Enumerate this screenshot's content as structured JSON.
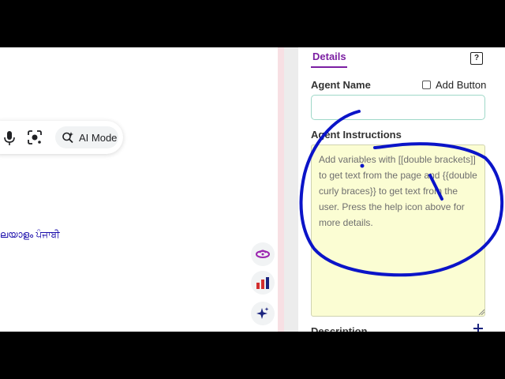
{
  "search": {
    "ai_mode_label": "AI Mode",
    "languages_fragment": "ലയാളം ਪੰਜਾਬੀ"
  },
  "panel": {
    "tab_details": "Details",
    "help_glyph": "?",
    "agent_name_label": "Agent Name",
    "agent_name_value": "",
    "add_button_label": "Add Button",
    "instructions_label": "Agent Instructions",
    "instructions_placeholder": "Add variables with [[double brackets]] to get text from the page and {{double curly braces}} to get text from the user. Press the help icon above for more details.",
    "description_label": "Description"
  },
  "colors": {
    "accent": "#7b1fa2",
    "textarea_bg": "#fbfdd3",
    "annotation_ink": "#0b14c8"
  },
  "icons": [
    "mic-icon",
    "camera-lens-icon",
    "ai-mode-sparkle-icon",
    "rocket-icon",
    "bar-chart-icon",
    "sparkle-icon",
    "help-icon",
    "plus-icon"
  ]
}
